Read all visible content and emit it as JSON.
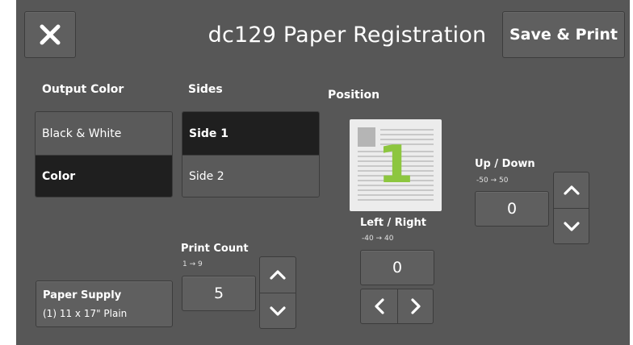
{
  "header": {
    "title": "dc129 Paper Registration",
    "close_icon": "close-icon",
    "save_label": "Save & Print"
  },
  "output_color": {
    "label": "Output Color",
    "options": [
      "Black & White",
      "Color"
    ],
    "selected": "Color"
  },
  "sides": {
    "label": "Sides",
    "options": [
      "Side 1",
      "Side 2"
    ],
    "selected": "Side 1"
  },
  "position": {
    "label": "Position",
    "preview_number": "1",
    "preview_color": "#8dc63f"
  },
  "left_right": {
    "label": "Left / Right",
    "range": "-40 → 40",
    "value": "0"
  },
  "up_down": {
    "label": "Up / Down",
    "range": "-50 → 50",
    "value": "0"
  },
  "print_count": {
    "label": "Print Count",
    "range": "1 → 9",
    "value": "5"
  },
  "paper_supply": {
    "title": "Paper Supply",
    "value": "(1) 11 x 17\" Plain"
  },
  "colors": {
    "background": "#575757",
    "selected": "#1f1f1f",
    "accent": "#8dc63f"
  }
}
